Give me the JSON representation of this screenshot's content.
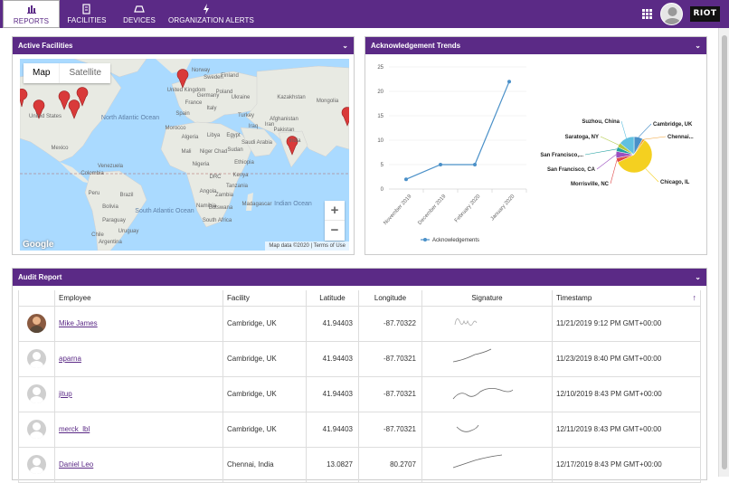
{
  "nav": {
    "items": [
      {
        "label": "REPORTS",
        "icon": "bar-chart-icon",
        "active": true
      },
      {
        "label": "FACILITIES",
        "icon": "document-icon",
        "active": false
      },
      {
        "label": "DEVICES",
        "icon": "device-icon",
        "active": false
      },
      {
        "label": "ORGANIZATION ALERTS",
        "icon": "lightning-icon",
        "active": false
      }
    ],
    "brand": "RIOT"
  },
  "colors": {
    "header": "#5b2a86",
    "accent": "#5b2a86",
    "line": "#4a90c8",
    "pin": "#d93a3a"
  },
  "facilities": {
    "title": "Active Facilities",
    "map_buttons": [
      "Map",
      "Satellite"
    ],
    "zoom_in": "+",
    "zoom_out": "−",
    "attribution": "Map data ©2020  |  Terms of Use",
    "google": "Google",
    "map_labels": [
      "North Atlantic Ocean",
      "South Atlantic Ocean",
      "Indian Ocean",
      "United States",
      "Mexico",
      "Venezuela",
      "Colombia",
      "Peru",
      "Brazil",
      "Bolivia",
      "Paraguay",
      "Chile",
      "Argentina",
      "Uruguay",
      "Morocco",
      "Algeria",
      "Libya",
      "Egypt",
      "Mali",
      "Niger",
      "Chad",
      "Sudan",
      "Nigeria",
      "Ethiopia",
      "DRC",
      "Kenya",
      "Tanzania",
      "Angola",
      "Namibia",
      "Zambia",
      "Botswana",
      "South Africa",
      "Madagascar",
      "Saudi Arabia",
      "Iraq",
      "Iran",
      "Turkey",
      "Afghanistan",
      "Pakistan",
      "India",
      "Kazakhstan",
      "Mongolia",
      "Ukraine",
      "Germany",
      "France",
      "Spain",
      "Italy",
      "Poland",
      "Sweden",
      "Finland",
      "United Kingdom",
      "Norway"
    ]
  },
  "trends": {
    "title": "Acknowledgement Trends",
    "legend": "Acknowledgements"
  },
  "chart_data": [
    {
      "type": "line",
      "x": [
        "November 2019",
        "December 2019",
        "February 2020",
        "January 2020"
      ],
      "series": [
        {
          "name": "Acknowledgements",
          "values": [
            2,
            5,
            5,
            22
          ]
        }
      ],
      "ylim": [
        0,
        25
      ],
      "yticks": [
        0,
        5,
        10,
        15,
        20,
        25
      ],
      "grid": true,
      "legend": "bottom"
    },
    {
      "type": "pie",
      "labels": [
        "Cambridge, UK",
        "Chennai...",
        "Chicago, IL",
        "Morrisville, NC",
        "San Francisco, CA",
        "San Francisco,...",
        "Saratoga, NY",
        "Suzhou, China"
      ],
      "values": [
        8,
        2,
        58,
        4,
        6,
        4,
        4,
        14
      ],
      "colors": [
        "#4a90c8",
        "#f0a030",
        "#f4d020",
        "#e04848",
        "#9b4fc0",
        "#20a0a0",
        "#b0c840",
        "#60c0e0"
      ]
    }
  ],
  "audit": {
    "title": "Audit Report",
    "columns": [
      "",
      "Employee",
      "Facility",
      "Latitude",
      "Longitude",
      "Signature",
      "Timestamp"
    ],
    "sort_icon": "↑",
    "rows": [
      {
        "employee": "Mike James",
        "facility": "Cambridge, UK",
        "latitude": "41.94403",
        "longitude": "-87.70322",
        "timestamp": "11/21/2019 9:12 PM GMT+00:00"
      },
      {
        "employee": "aparna",
        "facility": "Cambridge, UK",
        "latitude": "41.94403",
        "longitude": "-87.70321",
        "timestamp": "11/23/2019 8:40 PM GMT+00:00"
      },
      {
        "employee": "jitup",
        "facility": "Cambridge, UK",
        "latitude": "41.94403",
        "longitude": "-87.70321",
        "timestamp": "12/10/2019 8:43 PM GMT+00:00"
      },
      {
        "employee": "merck_lbl",
        "facility": "Cambridge, UK",
        "latitude": "41.94403",
        "longitude": "-87.70321",
        "timestamp": "12/11/2019 8:43 PM GMT+00:00"
      },
      {
        "employee": "Daniel Leo",
        "facility": "Chennai, India",
        "latitude": "13.0827",
        "longitude": "80.2707",
        "timestamp": "12/17/2019 8:43 PM GMT+00:00"
      }
    ]
  }
}
